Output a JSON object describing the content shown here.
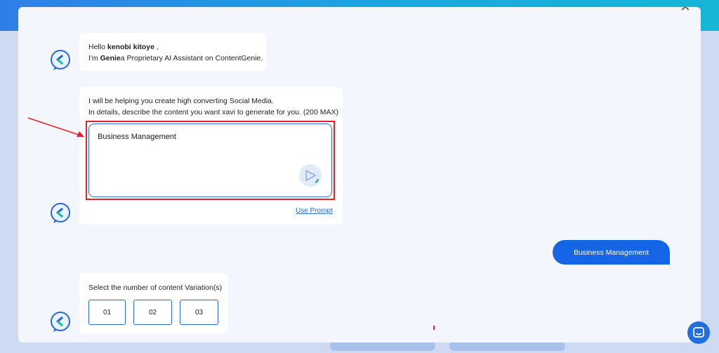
{
  "greeting": {
    "hello": "Hello ",
    "user_name": "kenobi kitoye",
    "comma": " ,",
    "im": "I'm ",
    "bot_name": "Genie",
    "intro": "a Proprietary AI Assistant on ContentGenie."
  },
  "prompt_message": {
    "line1": "I will be helping you create high converting Social Media.",
    "line2": "In details, describe the content you want xavi to generate for you. (200 MAX)",
    "input_value": "Business Management",
    "use_prompt_label": "Use Prompt"
  },
  "user_reply": {
    "text": "Business Management"
  },
  "variations": {
    "label": "Select the number of content Variation(s)",
    "options": [
      "01",
      "02",
      "03"
    ]
  },
  "colors": {
    "accent": "#1565e6",
    "annotation": "#e0242b"
  },
  "icons": {
    "avatar": "chat-bubble-logo-icon",
    "send": "send-arrow-icon",
    "close": "close-icon",
    "launcher": "chat-launcher-icon"
  }
}
